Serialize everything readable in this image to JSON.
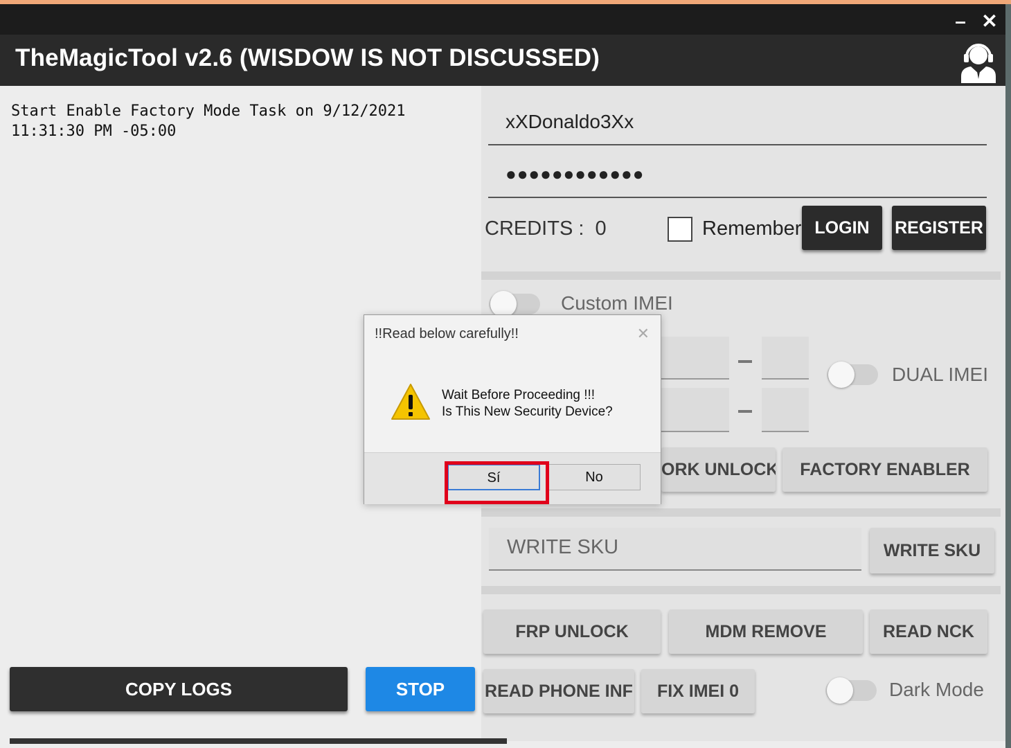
{
  "window": {
    "title": "TheMagicTool v2.6 (WISDOW IS NOT DISCUSSED)",
    "minimize_label": "–",
    "close_label": "✕",
    "support_icon": "support-agent-icon"
  },
  "log": {
    "text": "Start Enable Factory Mode Task on 9/12/2021\n11:31:30 PM -05:00"
  },
  "account": {
    "username": "xXDonaldo3Xx",
    "password": "●●●●●●●●●●●●",
    "credits_label": "CREDITS :",
    "credits_value": "0",
    "remember_label": "Remember",
    "remember_checked": false,
    "login_label": "LOGIN",
    "register_label": "REGISTER"
  },
  "imei": {
    "custom_label": "Custom IMEI",
    "dual_label": "DUAL IMEI"
  },
  "actions": {
    "network_unlock_label": "ORK UNLOCK",
    "factory_enabler_label": "FACTORY ENABLER",
    "write_sku_placeholder": "WRITE SKU",
    "write_sku_button": "WRITE SKU",
    "frp_unlock_label": "FRP UNLOCK",
    "mdm_remove_label": "MDM REMOVE",
    "read_nck_label": "READ NCK",
    "read_phone_info_label": "READ PHONE INF",
    "fix_imei_label": "FIX IMEI 0",
    "dark_mode_label": "Dark Mode"
  },
  "bottom": {
    "copy_logs_label": "COPY LOGS",
    "stop_label": "STOP"
  },
  "dialog": {
    "title": "!!Read below carefully!!",
    "close_label": "✕",
    "message": "Wait Before Proceeding !!!\n Is This New Security Device?",
    "yes_label": "Sí",
    "no_label": "No",
    "icon": "warning-icon"
  },
  "colors": {
    "titlebar": "#2a2a2a",
    "stop_button": "#1e88e5",
    "highlight": "#e0001b",
    "warning": "#f5c400"
  }
}
